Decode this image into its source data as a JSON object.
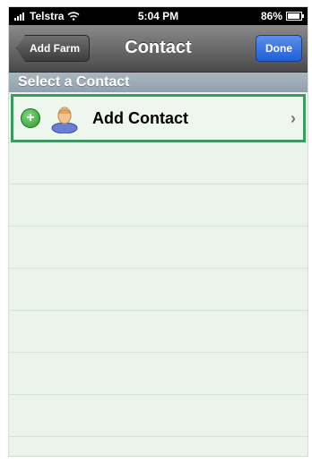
{
  "status_bar": {
    "carrier": "Telstra",
    "time": "5:04 PM",
    "battery": "86%",
    "icons": [
      "signal-bars-icon",
      "wifi-icon",
      "battery-icon"
    ]
  },
  "nav_bar": {
    "back_label": "Add Farm",
    "title": "Contact",
    "done_label": "Done",
    "done_color": "#2a66d9"
  },
  "section": {
    "header": "Select a Contact"
  },
  "add_contact": {
    "label": "Add Contact",
    "icons": [
      "plus-circle-icon",
      "person-icon",
      "chevron-right-icon"
    ],
    "highlight_color": "#3c9a60"
  },
  "colors": {
    "background": "#eaf4ea",
    "row_separator": "#d6e3d6",
    "nav_bar": "#6a6a6a",
    "section_header": "#9eacb7"
  }
}
